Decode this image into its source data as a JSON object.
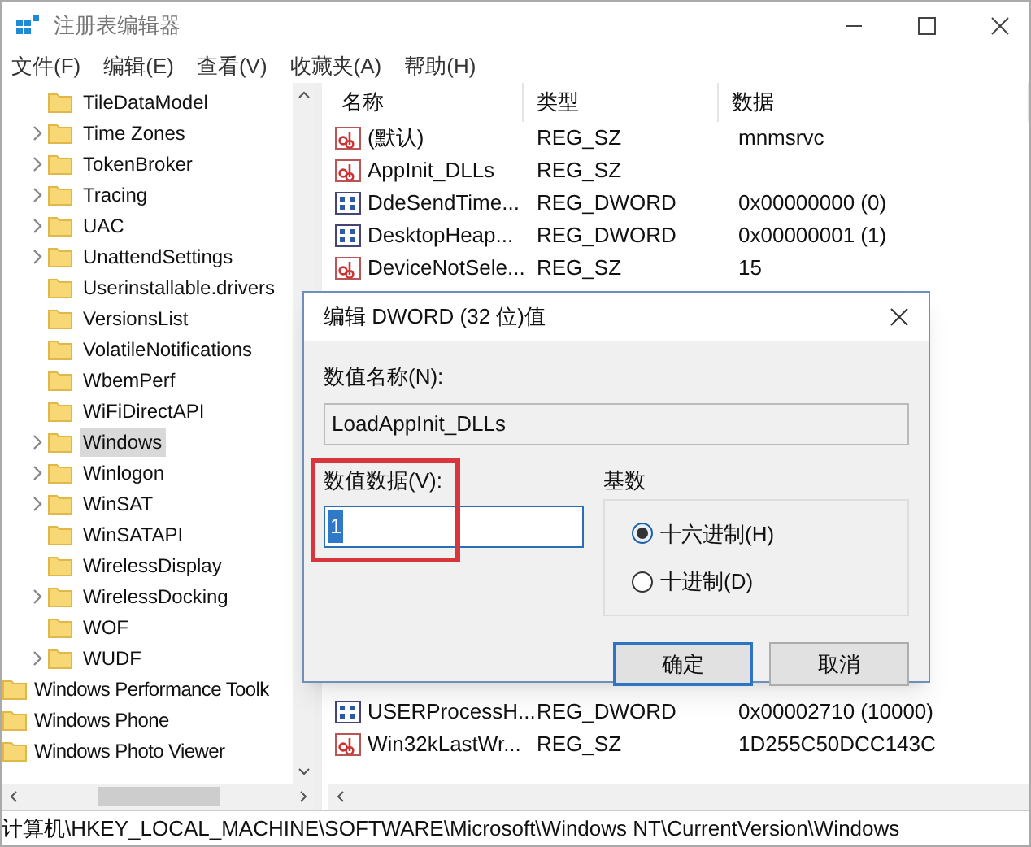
{
  "window": {
    "title": "注册表编辑器"
  },
  "menu": [
    "文件(F)",
    "编辑(E)",
    "查看(V)",
    "收藏夹(A)",
    "帮助(H)"
  ],
  "tree": {
    "items": [
      {
        "label": "TileDataModel",
        "expandable": false,
        "selected": false
      },
      {
        "label": "Time Zones",
        "expandable": true,
        "selected": false
      },
      {
        "label": "TokenBroker",
        "expandable": true,
        "selected": false
      },
      {
        "label": "Tracing",
        "expandable": true,
        "selected": false
      },
      {
        "label": "UAC",
        "expandable": true,
        "selected": false
      },
      {
        "label": "UnattendSettings",
        "expandable": true,
        "selected": false
      },
      {
        "label": "Userinstallable.drivers",
        "expandable": false,
        "selected": false
      },
      {
        "label": "VersionsList",
        "expandable": false,
        "selected": false
      },
      {
        "label": "VolatileNotifications",
        "expandable": false,
        "selected": false
      },
      {
        "label": "WbemPerf",
        "expandable": false,
        "selected": false
      },
      {
        "label": "WiFiDirectAPI",
        "expandable": false,
        "selected": false
      },
      {
        "label": "Windows",
        "expandable": true,
        "selected": true
      },
      {
        "label": "Winlogon",
        "expandable": true,
        "selected": false
      },
      {
        "label": "WinSAT",
        "expandable": true,
        "selected": false
      },
      {
        "label": "WinSATAPI",
        "expandable": false,
        "selected": false
      },
      {
        "label": "WirelessDisplay",
        "expandable": false,
        "selected": false
      },
      {
        "label": "WirelessDocking",
        "expandable": true,
        "selected": false
      },
      {
        "label": "WOF",
        "expandable": false,
        "selected": false
      },
      {
        "label": "WUDF",
        "expandable": true,
        "selected": false
      }
    ],
    "siblings": [
      "Windows Performance Toolk",
      "Windows Phone",
      "Windows Photo Viewer"
    ]
  },
  "values": {
    "columns": [
      "名称",
      "类型",
      "数据"
    ],
    "rows_top": [
      {
        "kind": "string",
        "name": "(默认)",
        "type": "REG_SZ",
        "data": "mnmsrvc"
      },
      {
        "kind": "string",
        "name": "AppInit_DLLs",
        "type": "REG_SZ"
      },
      {
        "kind": "binary",
        "name": "DdeSendTime...",
        "type": "REG_DWORD",
        "data": "0x00000000 (0)"
      },
      {
        "kind": "binary",
        "name": "DesktopHeap...",
        "type": "REG_DWORD",
        "data": "0x00000001 (1)"
      },
      {
        "kind": "string",
        "name": "DeviceNotSele...",
        "type": "REG_SZ",
        "data": "15"
      }
    ],
    "rows_bottom": [
      {
        "kind": "binary",
        "name": "USERProcessH...",
        "type": "REG_DWORD",
        "data": "0x00002710 (10000)"
      },
      {
        "kind": "string",
        "name": "Win32kLastWr...",
        "type": "REG_SZ",
        "data": "1D255C50DCC143C"
      }
    ]
  },
  "dialog": {
    "title": "编辑 DWORD (32 位)值",
    "name_label": "数值名称(N):",
    "name_value": "LoadAppInit_DLLs",
    "data_label": "数值数据(V):",
    "data_value": "1",
    "base_label": "基数",
    "bases": [
      {
        "label": "十六进制(H)",
        "selected": true
      },
      {
        "label": "十进制(D)",
        "selected": false
      }
    ],
    "buttons": [
      "确定",
      "取消"
    ]
  },
  "status_bar": "计算机\\HKEY_LOCAL_MACHINE\\SOFTWARE\\Microsoft\\Windows NT\\CurrentVersion\\Windows"
}
